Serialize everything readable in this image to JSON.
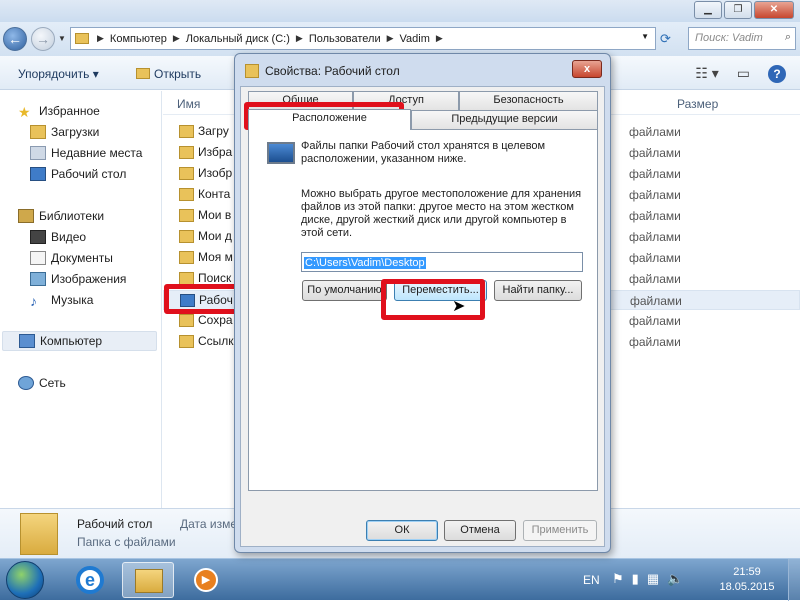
{
  "explorer": {
    "search_placeholder": "Поиск: Vadim",
    "breadcrumbs": [
      "Компьютер",
      "Локальный диск (C:)",
      "Пользователи",
      "Vadim"
    ],
    "toolbar": {
      "organize": "Упорядочить",
      "open": "Открыть"
    },
    "columns": {
      "name": "Имя",
      "size": "Размер"
    },
    "nav": {
      "favorites": "Избранное",
      "downloads": "Загрузки",
      "recent": "Недавние места",
      "desktop": "Рабочий стол",
      "libraries": "Библиотеки",
      "video": "Видео",
      "documents": "Документы",
      "images": "Изображения",
      "music": "Музыка",
      "computer": "Компьютер",
      "network": "Сеть"
    },
    "files": [
      {
        "name": "Загру",
        "type": "файлами"
      },
      {
        "name": "Избра",
        "type": "файлами"
      },
      {
        "name": "Изобр",
        "type": "файлами"
      },
      {
        "name": "Конта",
        "type": "файлами"
      },
      {
        "name": "Мои в",
        "type": "файлами"
      },
      {
        "name": "Мои д",
        "type": "файлами"
      },
      {
        "name": "Моя м",
        "type": "файлами"
      },
      {
        "name": "Поиск",
        "type": "файлами"
      },
      {
        "name": "Рабоч",
        "type": "файлами"
      },
      {
        "name": "Сохра",
        "type": "файлами"
      },
      {
        "name": "Ссылк",
        "type": "файлами"
      }
    ],
    "details": {
      "name": "Рабочий стол",
      "date_label": "Дата изме",
      "type": "Папка с файлами"
    }
  },
  "dialog": {
    "title": "Свойства: Рабочий стол",
    "close": "x",
    "tabs": {
      "general": "Общие",
      "access": "Доступ",
      "security": "Безопасность",
      "location": "Расположение",
      "previous": "Предыдущие версии"
    },
    "info1": "Файлы папки Рабочий стол хранятся в целевом расположении, указанном ниже.",
    "info2": "Можно выбрать другое местоположение для хранения файлов из этой папки: другое место на этом жестком диске, другой жесткий диск или другой компьютер в этой сети.",
    "path": "C:\\Users\\Vadim\\Desktop",
    "buttons": {
      "restore": "По умолчанию",
      "move": "Переместить...",
      "find": "Найти папку...",
      "ok": "ОК",
      "cancel": "Отмена",
      "apply": "Применить"
    }
  },
  "taskbar": {
    "lang": "EN",
    "time": "21:59",
    "date": "18.05.2015"
  },
  "colors": {
    "highlight": "#e0101c",
    "selection": "#3399ff"
  }
}
